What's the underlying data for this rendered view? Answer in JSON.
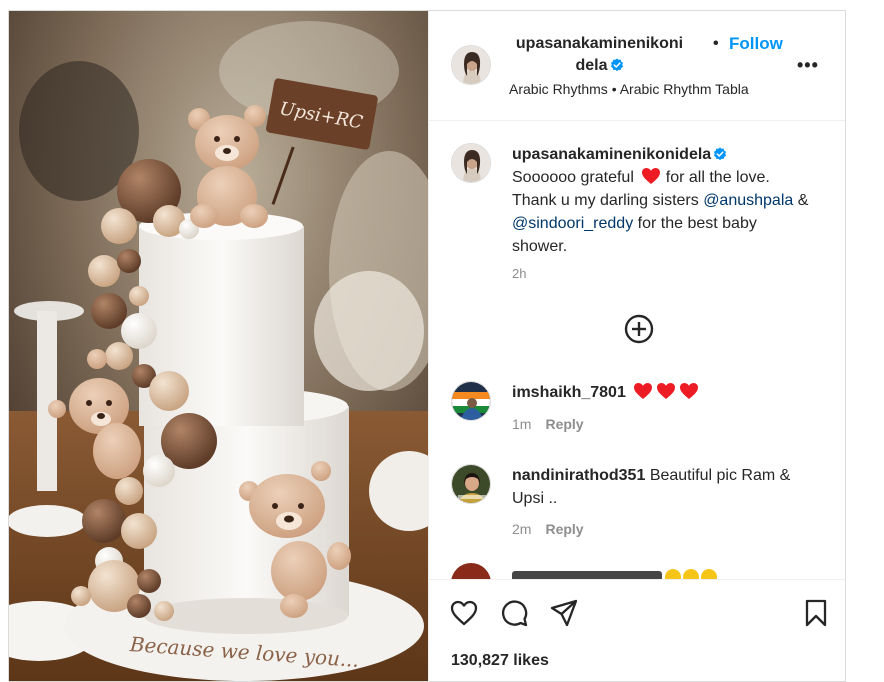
{
  "post": {
    "header": {
      "username": "upasanakaminenikonidela",
      "dot": "•",
      "follow_label": "Follow",
      "more_label": "•••",
      "audio": "Arabic Rhythms • Arabic Rhythm Tabla"
    },
    "media": {
      "plaque_text": "Upsi+RC",
      "cake_text": "Because we love you..."
    },
    "caption": {
      "username": "upasanakaminenikonidela",
      "text_part1": "Soooooo grateful",
      "text_part2": "for all the love. Thank u my darling sisters",
      "mention1": "@anushpala",
      "amp": "&",
      "mention2": "@sindoori_reddy",
      "text_part3": "for the best baby shower.",
      "time": "2h"
    },
    "comments": [
      {
        "username": "imshaikh_7801",
        "text": "",
        "hearts": 3,
        "time": "1m",
        "reply_label": "Reply"
      },
      {
        "username": "nandinirathod351",
        "text": "Beautiful pic Ram & Upsi ..",
        "time": "2m",
        "reply_label": "Reply"
      }
    ],
    "likes": "130,827 likes"
  },
  "colors": {
    "accent": "#0095f6",
    "mention": "#00376b",
    "heart": "#ed1c24",
    "verified": "#0095f6",
    "muted": "#8e8e8e"
  },
  "icons": [
    "verified-icon",
    "more-icon",
    "plus-circle-icon",
    "heart-icon",
    "comment-icon",
    "share-icon",
    "bookmark-icon"
  ]
}
